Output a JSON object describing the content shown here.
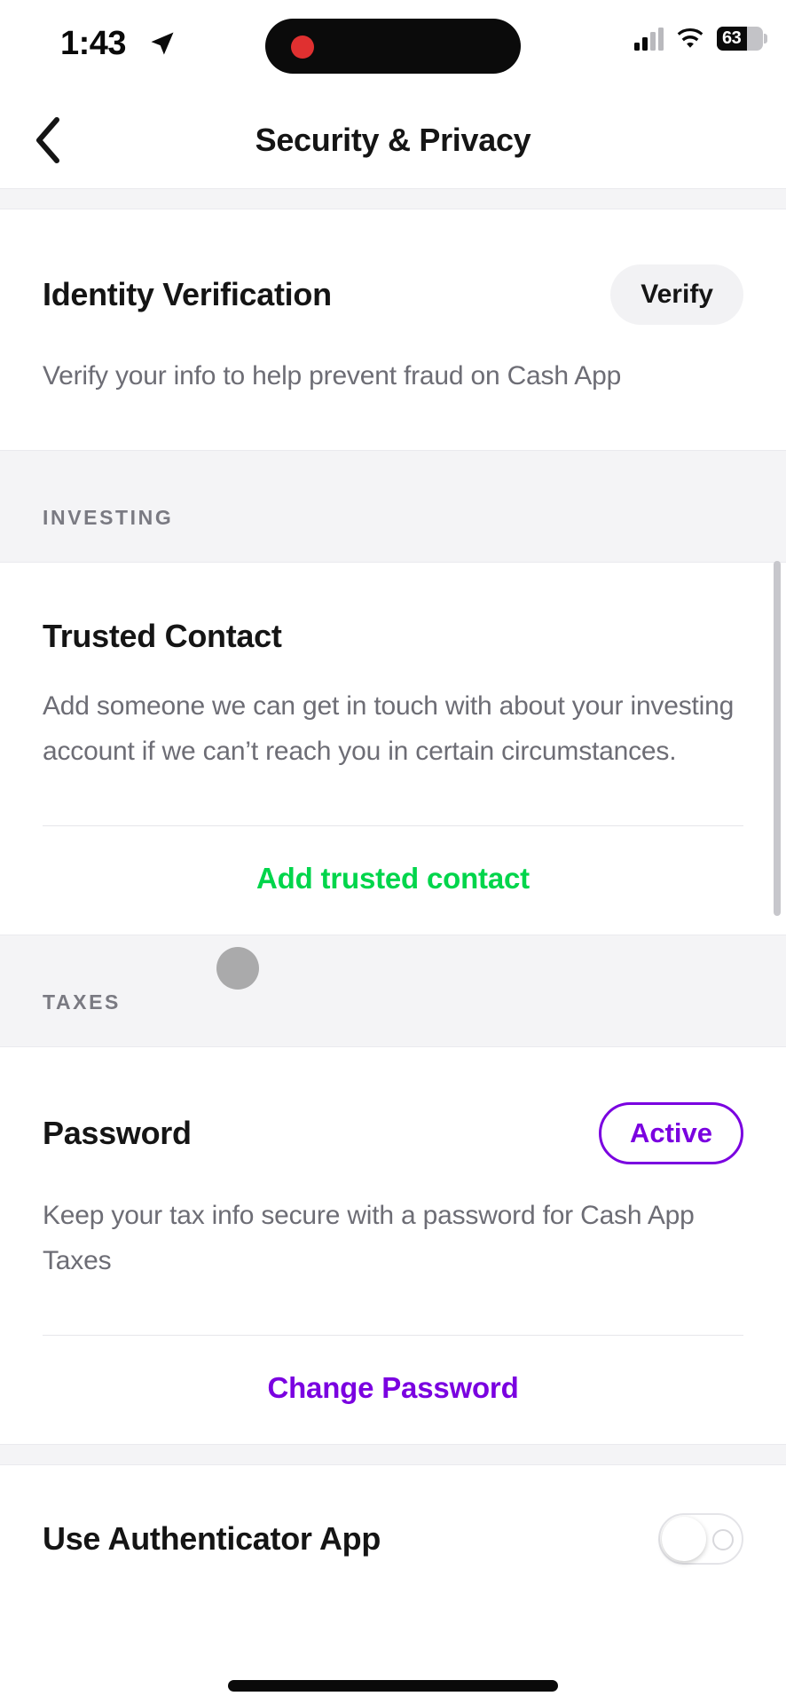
{
  "status_bar": {
    "time": "1:43",
    "location_icon": "location-arrow-icon",
    "recording_icon": "recording-dot-icon",
    "signal_icon": "cellular-signal-icon",
    "wifi_icon": "wifi-icon",
    "battery_percent": "63",
    "battery_icon": "battery-icon"
  },
  "nav": {
    "back_icon": "chevron-left-icon",
    "title": "Security & Privacy"
  },
  "identity": {
    "title": "Identity Verification",
    "button_label": "Verify",
    "description": "Verify your info to help prevent fraud on Cash App"
  },
  "investing": {
    "section_label": "INVESTING",
    "title": "Trusted Contact",
    "description": "Add someone we can get in touch with about your investing account if we can’t reach you in certain circumstances.",
    "action_label": "Add trusted contact"
  },
  "taxes": {
    "section_label": "TAXES",
    "title": "Password",
    "badge_label": "Active",
    "description": "Keep your tax info secure with a password for Cash App Taxes",
    "action_label": "Change Password"
  },
  "authenticator": {
    "title": "Use Authenticator App",
    "toggle_state": "off"
  },
  "colors": {
    "accent_green": "#00D54B",
    "accent_purple": "#7A00E0",
    "section_bg": "#F4F4F6",
    "text_primary": "#151515",
    "text_secondary": "#6D6D75"
  }
}
